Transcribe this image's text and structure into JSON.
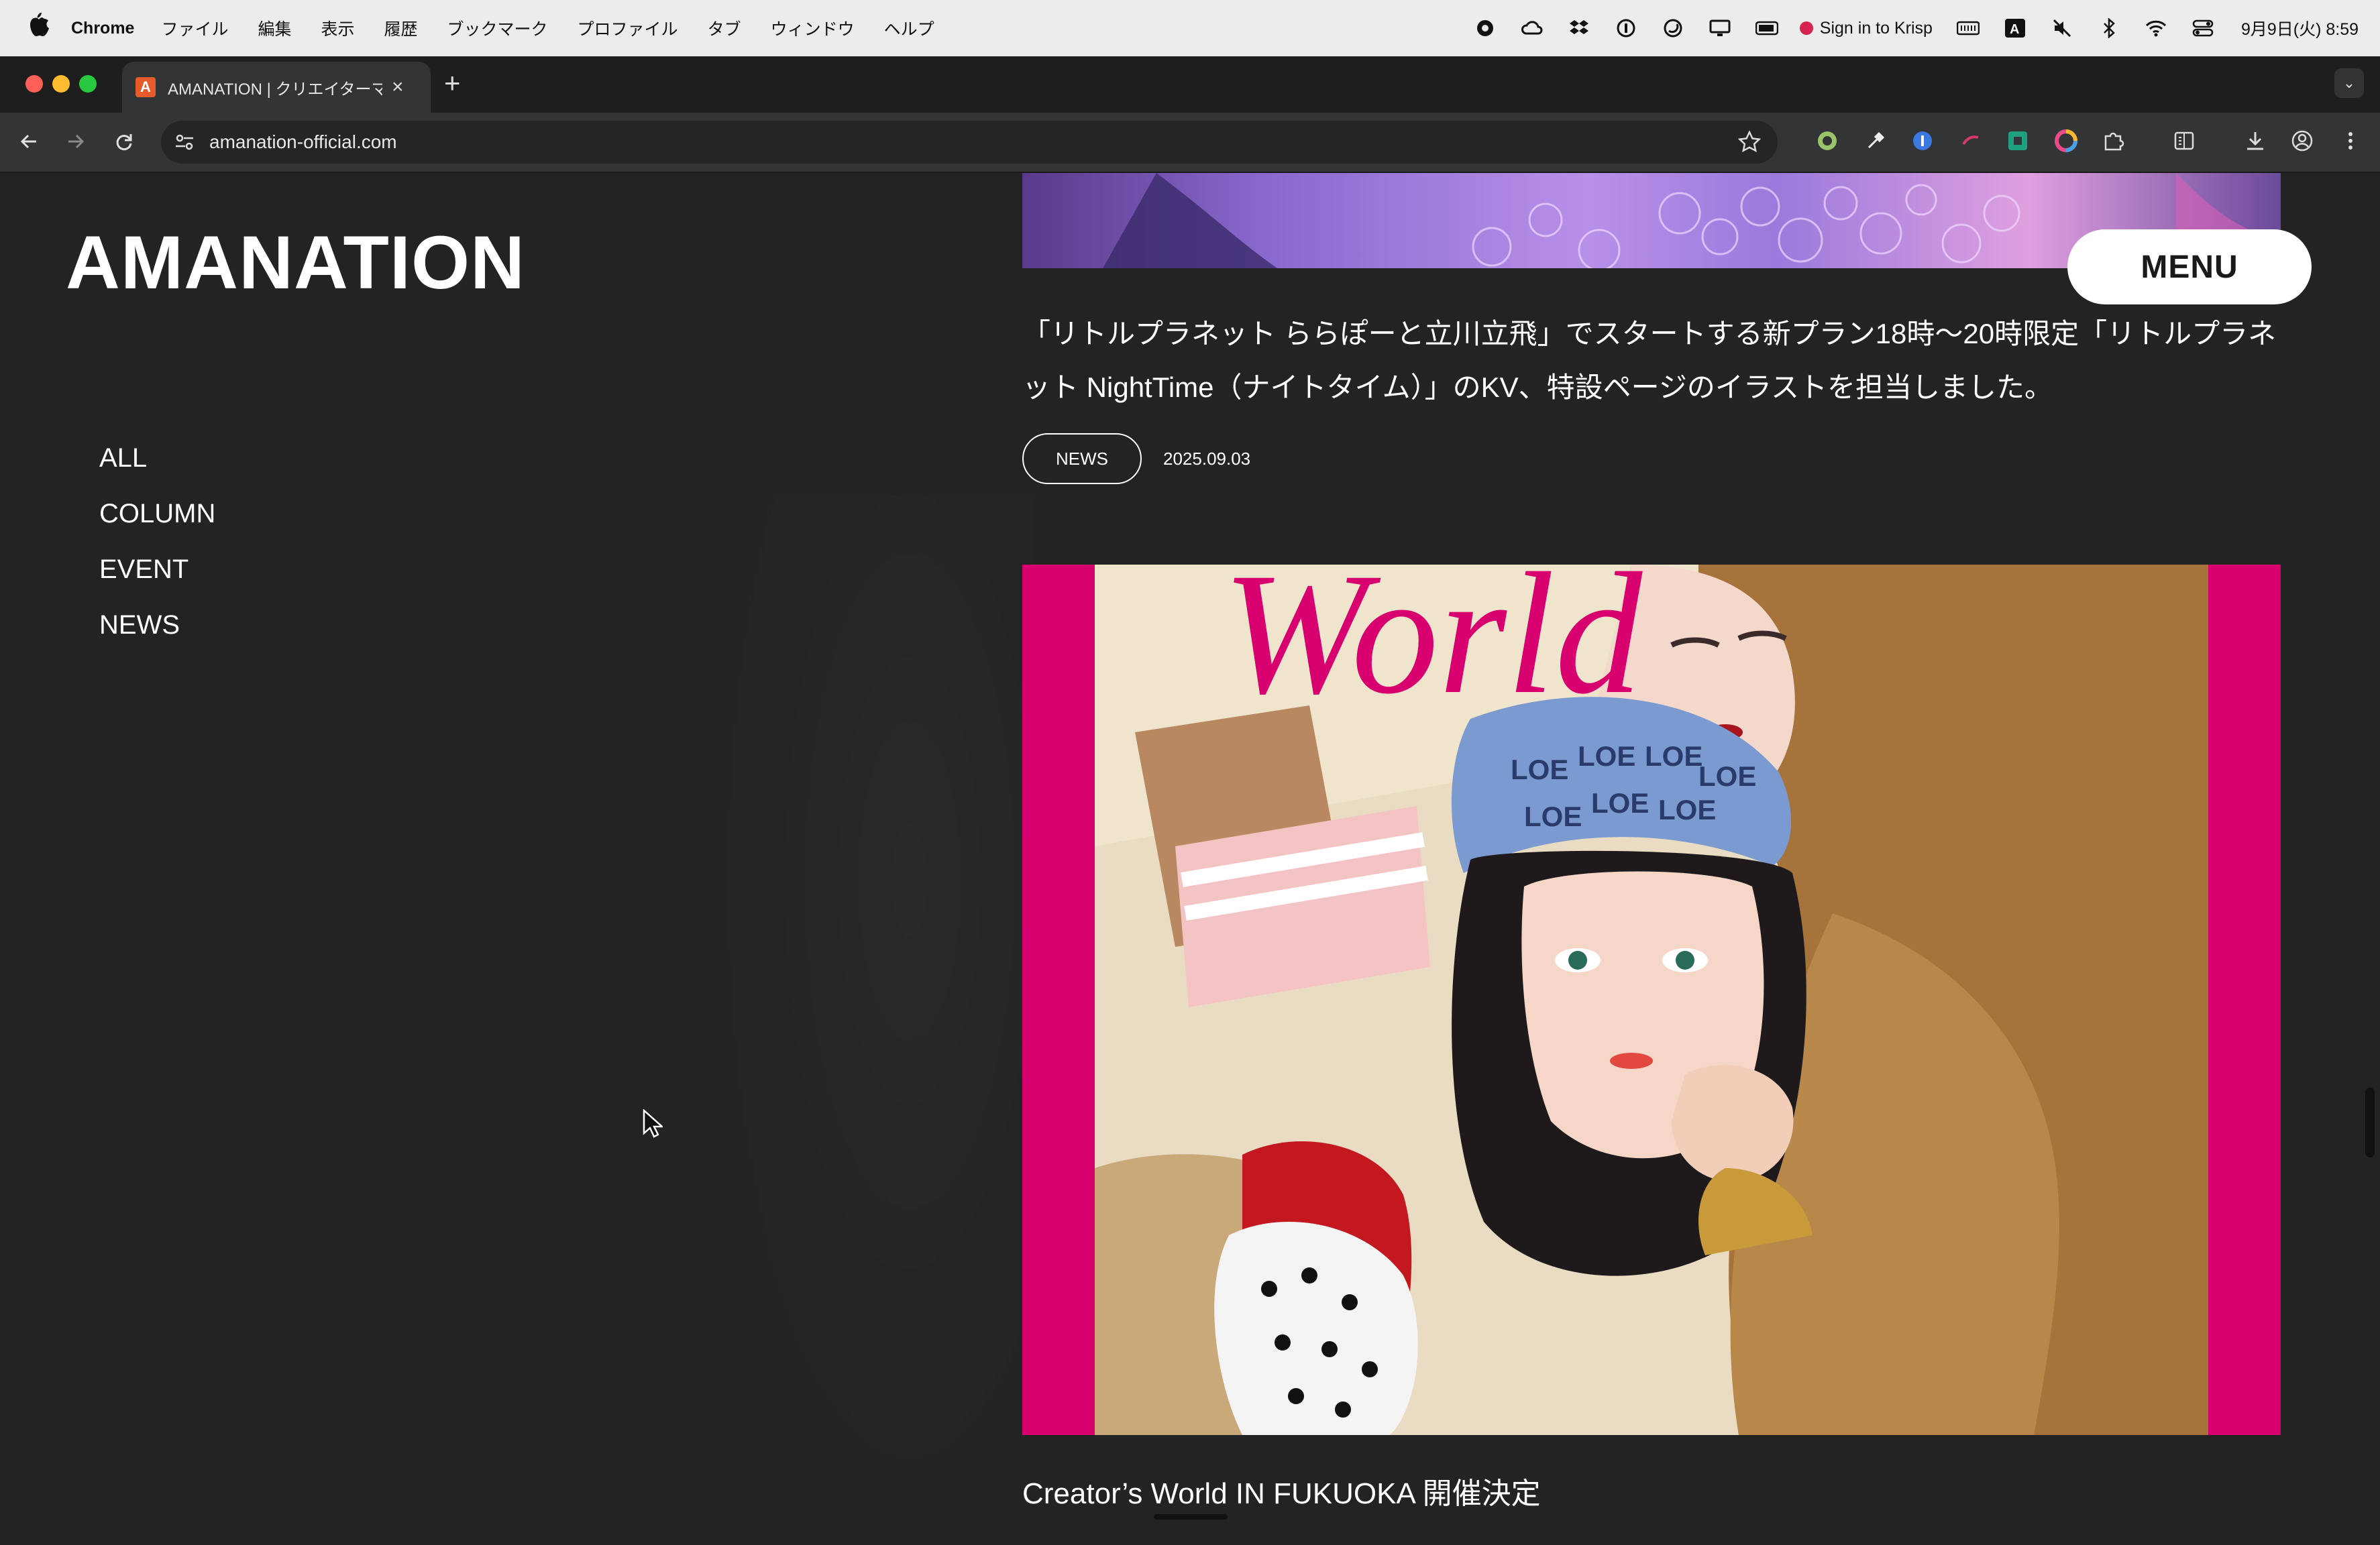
{
  "menubar": {
    "app_name": "Chrome",
    "menus": [
      "ファイル",
      "編集",
      "表示",
      "履歴",
      "ブックマーク",
      "プロファイル",
      "タブ",
      "ウィンドウ",
      "ヘルプ"
    ],
    "krisp_label": "Sign in to Krisp",
    "clock": "9月9日(火) 8:59"
  },
  "browser": {
    "tab_title": "AMANATION | クリエイターマネ",
    "favicon_letter": "A",
    "url": "amanation-official.com"
  },
  "site": {
    "logo": "AMANATION",
    "nav": [
      "ALL",
      "COLUMN",
      "EVENT",
      "NEWS"
    ],
    "menu_button": "MENU"
  },
  "articles": [
    {
      "title": "「リトルプラネット ららぽーと立川立飛」でスタートする新プラン18時〜20時限定「リトルプラネット NightTime（ナイトタイム）」のKV、特設ページのイラストを担当しました。",
      "tag": "NEWS",
      "date": "2025.09.03"
    },
    {
      "art_text": "World",
      "title": "Creator’s World IN FUKUOKA 開催決定"
    }
  ],
  "colors": {
    "page_bg": "#232323",
    "art_border": "#d8006f",
    "menubar_bg": "#ececec",
    "toolbar_bg": "#333436"
  }
}
